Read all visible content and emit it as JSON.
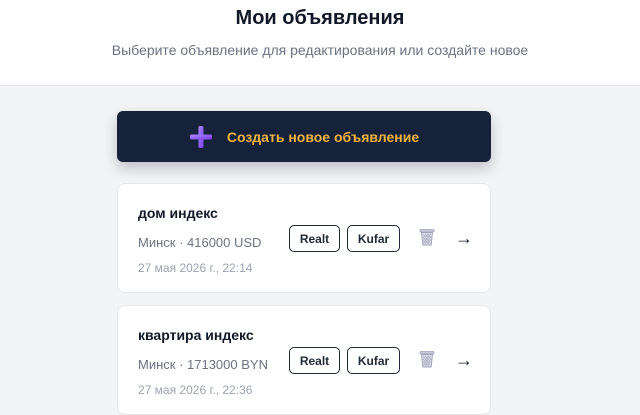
{
  "header": {
    "title": "Мои объявления",
    "subtitle": "Выберите объявление для редактирования или создайте новое"
  },
  "create_button": {
    "label": "Создать новое объявление",
    "icon": "plus-icon",
    "text_color": "#f0b43c",
    "background": "#16213a"
  },
  "listings": [
    {
      "title": "дом индекс",
      "meta": "Минск · 416000 USD",
      "date": "27 мая 2026 г., 22:14",
      "realt_label": "Realt",
      "kufar_label": "Kufar",
      "delete_icon": "trash-icon",
      "open_icon": "arrow-right-icon",
      "arrow": "→"
    },
    {
      "title": "квартира индекс",
      "meta": "Минск · 1713000 BYN",
      "date": "27 мая 2026 г., 22:36",
      "realt_label": "Realt",
      "kufar_label": "Kufar",
      "delete_icon": "trash-icon",
      "open_icon": "arrow-right-icon",
      "arrow": "→"
    }
  ]
}
